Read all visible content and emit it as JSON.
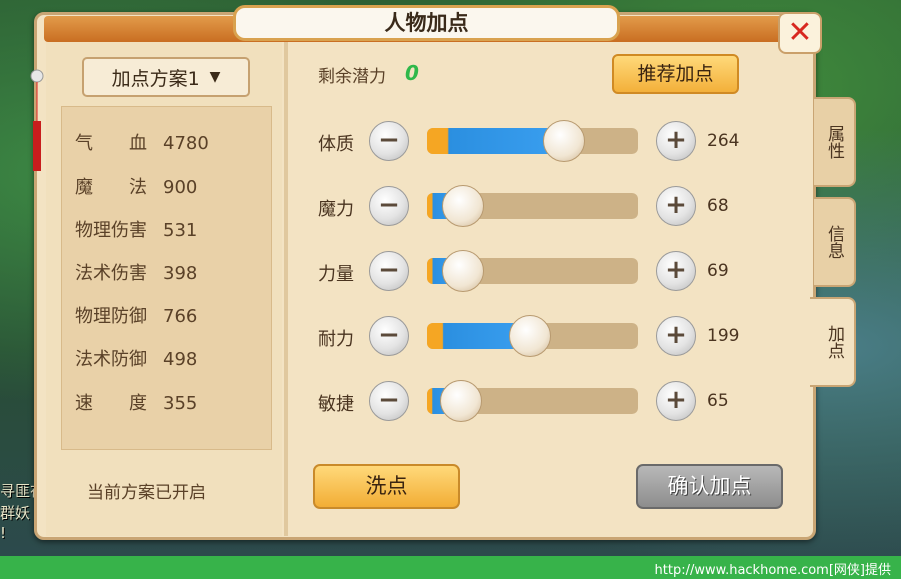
{
  "background": {
    "chat_line_1": "寻匪在",
    "chat_line_2": "群妖",
    "chat_line_3": "!"
  },
  "title": "人物加点",
  "close_icon": "close-x-icon",
  "scheme": {
    "label": "加点方案1",
    "chevron": "chevron-down-icon"
  },
  "stats": [
    {
      "label": "气　　血",
      "value": "4780"
    },
    {
      "label": "魔　　法",
      "value": "900"
    },
    {
      "label": "物理伤害",
      "value": "531"
    },
    {
      "label": "法术伤害",
      "value": "398"
    },
    {
      "label": "物理防御",
      "value": "766"
    },
    {
      "label": "法术防御",
      "value": "498"
    },
    {
      "label": "速　　度",
      "value": "355"
    }
  ],
  "scheme_status": "当前方案已开启",
  "potential": {
    "label": "剩余潜力",
    "value": "0"
  },
  "recommend_label": "推荐加点",
  "attributes": [
    {
      "name": "体质",
      "value": "264",
      "level": 0.65
    },
    {
      "name": "魔力",
      "value": "68",
      "level": 0.17
    },
    {
      "name": "力量",
      "value": "69",
      "level": 0.17
    },
    {
      "name": "耐力",
      "value": "199",
      "level": 0.49
    },
    {
      "name": "敏捷",
      "value": "65",
      "level": 0.16
    }
  ],
  "minus_glyph": "−",
  "plus_glyph": "+",
  "reset_label": "洗点",
  "confirm_label": "确认加点",
  "tabs": [
    {
      "label": "属性",
      "active": false
    },
    {
      "label": "信息",
      "active": false
    },
    {
      "label": "加点",
      "active": true
    }
  ],
  "footer": "http://www.hackhome.com[网侠]提供"
}
